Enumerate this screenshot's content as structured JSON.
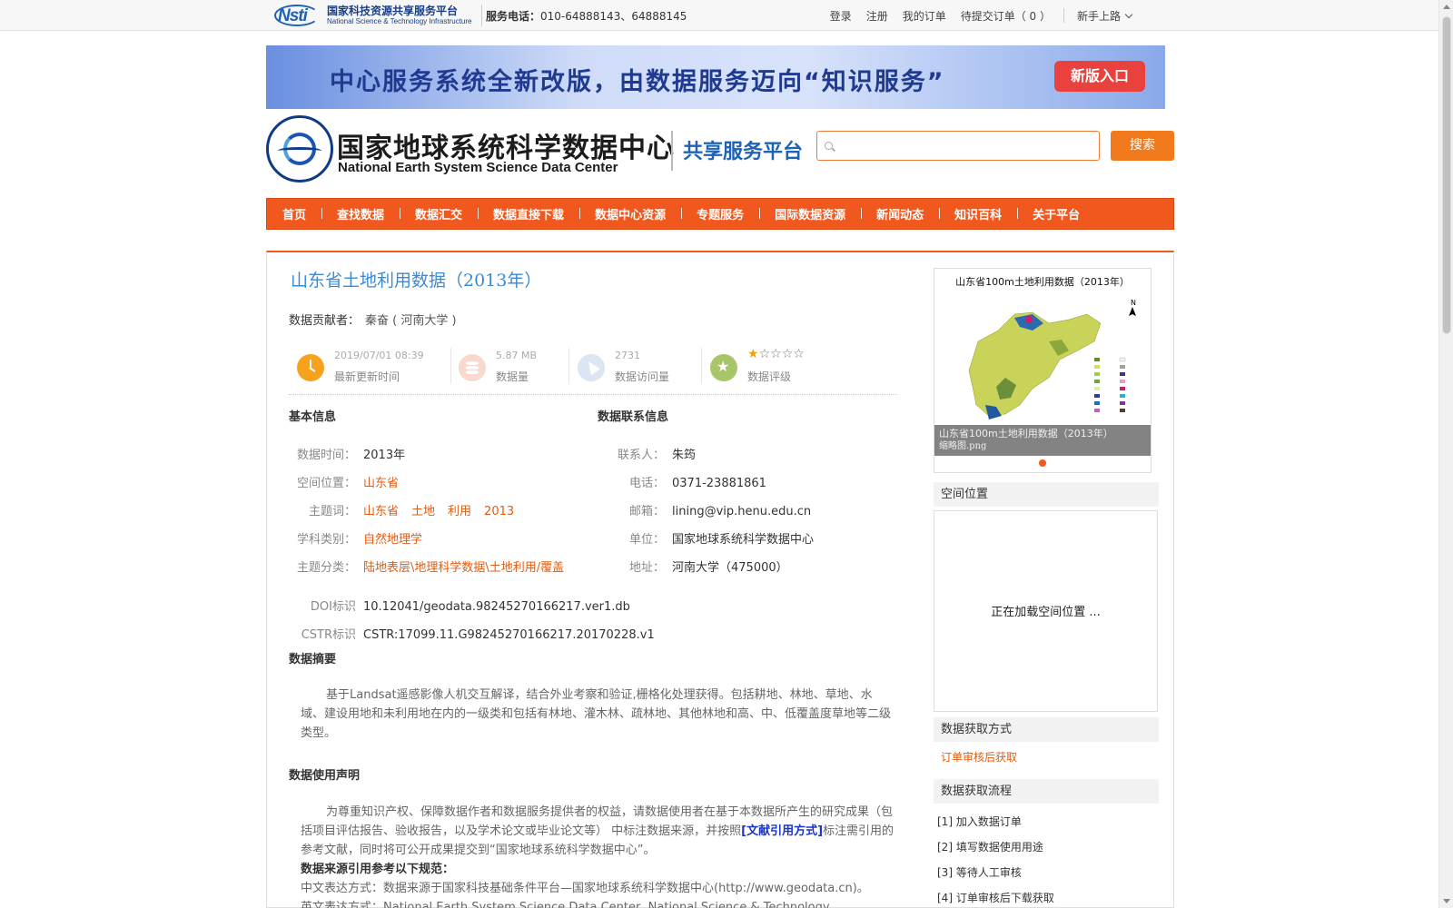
{
  "topbar": {
    "logo_mark": "Nsti",
    "logo_cn": "国家科技资源共享服务平台",
    "logo_en": "National Science & Technology Infrastructure",
    "phone_label": "服务电话：",
    "phone_numbers": "010-64888143、64888145",
    "links": [
      "登录",
      "注册",
      "我的订单",
      "待提交订单（ 0 ）"
    ],
    "newbie": "新手上路"
  },
  "banner": {
    "text": "中心服务系统全新改版，由数据服务迈向“知识服务”",
    "button": "新版入口"
  },
  "header": {
    "name_cn": "国家地球系统科学数据中心",
    "name_en": "National Earth System Science Data Center",
    "platform": "共享服务平台",
    "search_placeholder": "",
    "search_button": "搜索"
  },
  "nav": [
    "首页",
    "查找数据",
    "数据汇交",
    "数据直接下载",
    "数据中心资源",
    "专题服务",
    "国际数据资源",
    "新闻动态",
    "知识百科",
    "关于平台"
  ],
  "dataset": {
    "title": "山东省土地利用数据（2013年）",
    "contributor_label": "数据贡献者：",
    "contributor": "秦奋 ( 河南大学 )",
    "stats": {
      "updated_value": "2019/07/01 08:39",
      "updated_label": "最新更新时间",
      "size_value": "5.87 MB",
      "size_label": "数据量",
      "visits_value": "2731",
      "visits_label": "数据访问量",
      "rating_label": "数据评级",
      "rating_stars": 1,
      "rating_max": 5
    }
  },
  "basic": {
    "heading": "基本信息",
    "time_label": "数据时间：",
    "time": "2013年",
    "space_label": "空间位置：",
    "space": "山东省",
    "keywords_label": "主题词：",
    "keywords": [
      "山东省",
      "土地",
      "利用",
      "2013"
    ],
    "discipline_label": "学科类别：",
    "discipline": "自然地理学",
    "category_label": "主题分类：",
    "category": "陆地表层\\地理科学数据\\土地利用/覆盖",
    "doi_label": "DOI标识",
    "doi": "10.12041/geodata.98245270166217.ver1.db",
    "cstr_label": "CSTR标识",
    "cstr": "CSTR:17099.11.G98245270166217.20170228.v1"
  },
  "contact": {
    "heading": "数据联系信息",
    "person_label": "联系人：",
    "person": "朱筠",
    "phone_label": "电话：",
    "phone": "0371-23881861",
    "email_label": "邮箱：",
    "email": "lining@vip.henu.edu.cn",
    "org_label": "单位：",
    "org": "国家地球系统科学数据中心",
    "addr_label": "地址：",
    "addr": "河南大学（475000）"
  },
  "abstract": {
    "heading": "数据摘要",
    "text": "基于Landsat遥感影像人机交互解译，结合外业考察和验证,栅格化处理获得。包括耕地、林地、草地、水域、建设用地和未利用地在内的一级类和包括有林地、灌木林、疏林地、其他林地和高、中、低覆盖度草地等二级类型。"
  },
  "usage": {
    "heading": "数据使用声明",
    "text_before": "为尊重知识产权、保障数据作者和数据服务提供者的权益，请数据使用者在基于本数据所产生的研究成果（包括项目评估报告、验收报告，以及学术论文或毕业论文等） 中标注数据来源，并按照",
    "cite_link": "[文献引用方式]",
    "text_after": "标注需引用的参考文献，同时将可公开成果提交到“国家地球系统科学数据中心”。",
    "source_heading": "数据来源引用参考以下规范：",
    "cn_line": "中文表达方式：数据来源于国家科技基础条件平台—国家地球系统科学数据中心(http://www.geodata.cn)。",
    "en_line": "英文表达方式：National Earth System Science Data Center, National Science & Technology"
  },
  "thumbnail": {
    "title": "山东省100m土地利用数据（2013年）",
    "caption_line1": "山东省100m土地利用数据（2013年）",
    "caption_line2": "缩略图.png"
  },
  "sidebar": {
    "spatial_heading": "空间位置",
    "spatial_loading": "正在加载空间位置 ...",
    "access_heading": "数据获取方式",
    "access_value": "订单审核后获取",
    "process_heading": "数据获取流程",
    "steps": [
      "[1] 加入数据订单",
      "[2] 填写数据使用用途",
      "[3] 等待人工审核",
      "[4] 订单审核后下载获取"
    ]
  },
  "colors": {
    "nav_bg": "#f0581e",
    "title_blue": "#3a8ad6",
    "link_orange": "#e05c10",
    "search_button": "#f07a1c",
    "banner_button": "#e8413e"
  }
}
